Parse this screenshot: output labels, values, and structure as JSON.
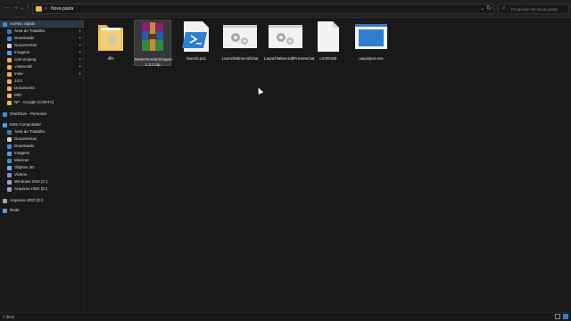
{
  "toolbar": {
    "back_icon": "back-arrow-icon",
    "forward_icon": "forward-arrow-icon",
    "down_icon": "chevron-down-icon",
    "up_icon": "up-arrow-icon"
  },
  "address": {
    "separator": ">",
    "path": "Nova pasta"
  },
  "search": {
    "placeholder": "Pesquisar em Nova pasta"
  },
  "sidebar": {
    "items": [
      {
        "label": "Acesso rápido",
        "icon": "star-icon",
        "color": "#3c8fdc",
        "pinned": false
      },
      {
        "label": "Área de Trabalho",
        "icon": "desktop-icon",
        "color": "#3b7bc4",
        "pinned": true
      },
      {
        "label": "Downloads",
        "icon": "download-icon",
        "color": "#3c8fdc",
        "pinned": true
      },
      {
        "label": "Documentos",
        "icon": "document-icon",
        "color": "#cfcfcf",
        "pinned": true
      },
      {
        "label": "Imagens",
        "icon": "image-icon",
        "color": "#4ea3e0",
        "pinned": true
      },
      {
        "label": "com.mojang",
        "icon": "folder-icon",
        "color": "#e8b64a",
        "pinned": true
      },
      {
        "label": ".minecraft",
        "icon": "folder-icon",
        "color": "#e8b64a",
        "pinned": true
      },
      {
        "label": "mine",
        "icon": "folder-icon",
        "color": "#e8b64a",
        "pinned": true
      },
      {
        "label": "14.0",
        "icon": "folder-icon",
        "color": "#e8b64a",
        "pinned": false
      },
      {
        "label": "Documents",
        "icon": "folder-icon",
        "color": "#e8b64a",
        "pinned": false
      },
      {
        "label": "MEI",
        "icon": "folder-icon",
        "color": "#e8b64a",
        "pinned": false
      },
      {
        "label": "NF - Google (CONTA)",
        "icon": "folder-icon",
        "color": "#e8b64a",
        "pinned": false
      },
      {
        "label": "OneDrive - Personal",
        "icon": "cloud-icon",
        "color": "#3c8fdc",
        "pinned": false
      },
      {
        "label": "Este Computador",
        "icon": "computer-icon",
        "color": "#4ea3e0",
        "pinned": false
      },
      {
        "label": "Área de Trabalho",
        "icon": "desktop-icon",
        "color": "#3b7bc4",
        "pinned": false
      },
      {
        "label": "Documentos",
        "icon": "document-icon",
        "color": "#cfcfcf",
        "pinned": false
      },
      {
        "label": "Downloads",
        "icon": "download-icon",
        "color": "#3c8fdc",
        "pinned": false
      },
      {
        "label": "Imagens",
        "icon": "image-icon",
        "color": "#4ea3e0",
        "pinned": false
      },
      {
        "label": "Músicas",
        "icon": "music-icon",
        "color": "#3c8fdc",
        "pinned": false
      },
      {
        "label": "Objetos 3D",
        "icon": "cube-icon",
        "color": "#6bb8e8",
        "pinned": false
      },
      {
        "label": "Vídeos",
        "icon": "video-icon",
        "color": "#9a7fd6",
        "pinned": false
      },
      {
        "label": "Windows SSD (C:)",
        "icon": "drive-icon",
        "color": "#9aa5b1",
        "pinned": false
      },
      {
        "label": "Arquivos HDD (D:)",
        "icon": "drive-icon",
        "color": "#9aa5b1",
        "pinned": false
      },
      {
        "label": "Arquivos HDD (D:)",
        "icon": "drive-icon",
        "color": "#9aa5b1",
        "pinned": false
      },
      {
        "label": "Rede",
        "icon": "network-icon",
        "color": "#4ea3e0",
        "pinned": false
      }
    ]
  },
  "files": [
    {
      "name": "dlls",
      "type": "folder",
      "icon": "folder-gear-icon"
    },
    {
      "name": "BetterRenderDragon-1.3.3.zip",
      "type": "zip",
      "icon": "winrar-archive-icon",
      "selected": true
    },
    {
      "name": "launch.ps1",
      "type": "powershell",
      "icon": "powershell-icon"
    },
    {
      "name": "LaunchMinecraft.bat",
      "type": "bat",
      "icon": "batch-file-icon"
    },
    {
      "name": "LaunchMinecraftPreview.bat",
      "type": "bat",
      "icon": "batch-file-icon"
    },
    {
      "name": "LICENSE",
      "type": "file",
      "icon": "blank-file-icon"
    },
    {
      "name": "uwpinject.exe",
      "type": "exe",
      "icon": "exe-app-icon"
    }
  ],
  "status": {
    "count": "7 itens"
  },
  "colors": {
    "background": "#191919",
    "accent": "#3c8fdc",
    "selection": "#383838"
  }
}
